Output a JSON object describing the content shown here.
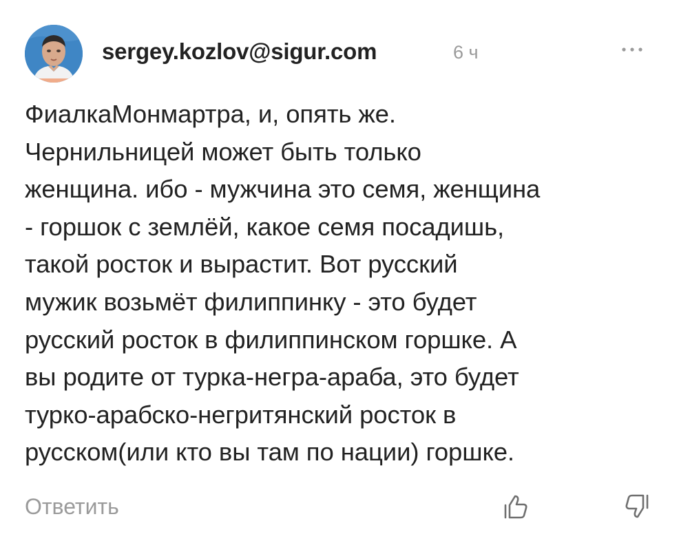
{
  "comment": {
    "author": "sergey.kozlov@sigur.com",
    "time": "6 ч",
    "avatar_icon": "user-photo-avatar",
    "more_icon": "more-options-icon",
    "text": "ФиалкаМонмартра, и, опять же.\nЧернильницей может быть только\nженщина. ибо - мужчина это семя, женщина\n- горшок с землёй, какое семя посадишь,\nтакой росток и вырастит. Вот русский\nмужик возьмёт филиппинку - это будет\nрусский росток в филиппинском горшке. А\nвы родите от турка-негра-араба, это будет\nтурко-арабско-негритянский росток в\nрусском(или кто вы там по нации) горшке.",
    "reply_label": "Ответить",
    "like_icon": "thumbs-up-icon",
    "dislike_icon": "thumbs-down-icon"
  },
  "colors": {
    "text": "#222222",
    "muted": "#9a9a9a",
    "avatar_bg": "#3f86c5"
  }
}
